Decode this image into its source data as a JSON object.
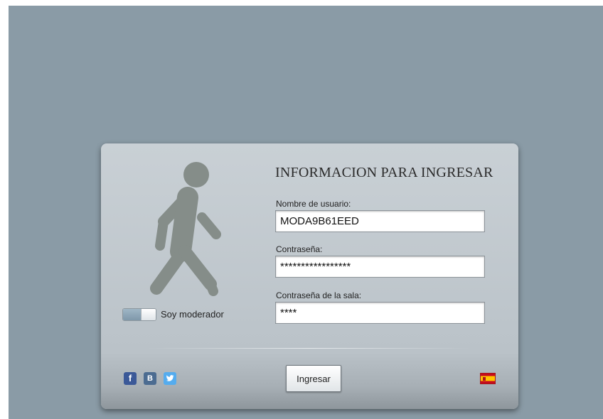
{
  "login_panel": {
    "title": "INFORMACION PARA INGRESAR",
    "username": {
      "label": "Nombre de usuario:",
      "value": "MODA9B61EED"
    },
    "password": {
      "label": "Contraseña:",
      "value": "*****************"
    },
    "room_password": {
      "label": "Contraseña de la sala:",
      "value": "****"
    },
    "moderator_toggle": {
      "label": "Soy moderador"
    },
    "login_button": "Ingresar"
  },
  "social": [
    {
      "name": "facebook-icon",
      "glyph": "f"
    },
    {
      "name": "vk-icon",
      "glyph": "B"
    },
    {
      "name": "twitter-icon",
      "glyph": "🐦"
    }
  ],
  "language_flag": "spain-flag-icon",
  "colors": {
    "background": "#8a9ba6",
    "panel": "#c3cace",
    "walker": "#858d89"
  }
}
